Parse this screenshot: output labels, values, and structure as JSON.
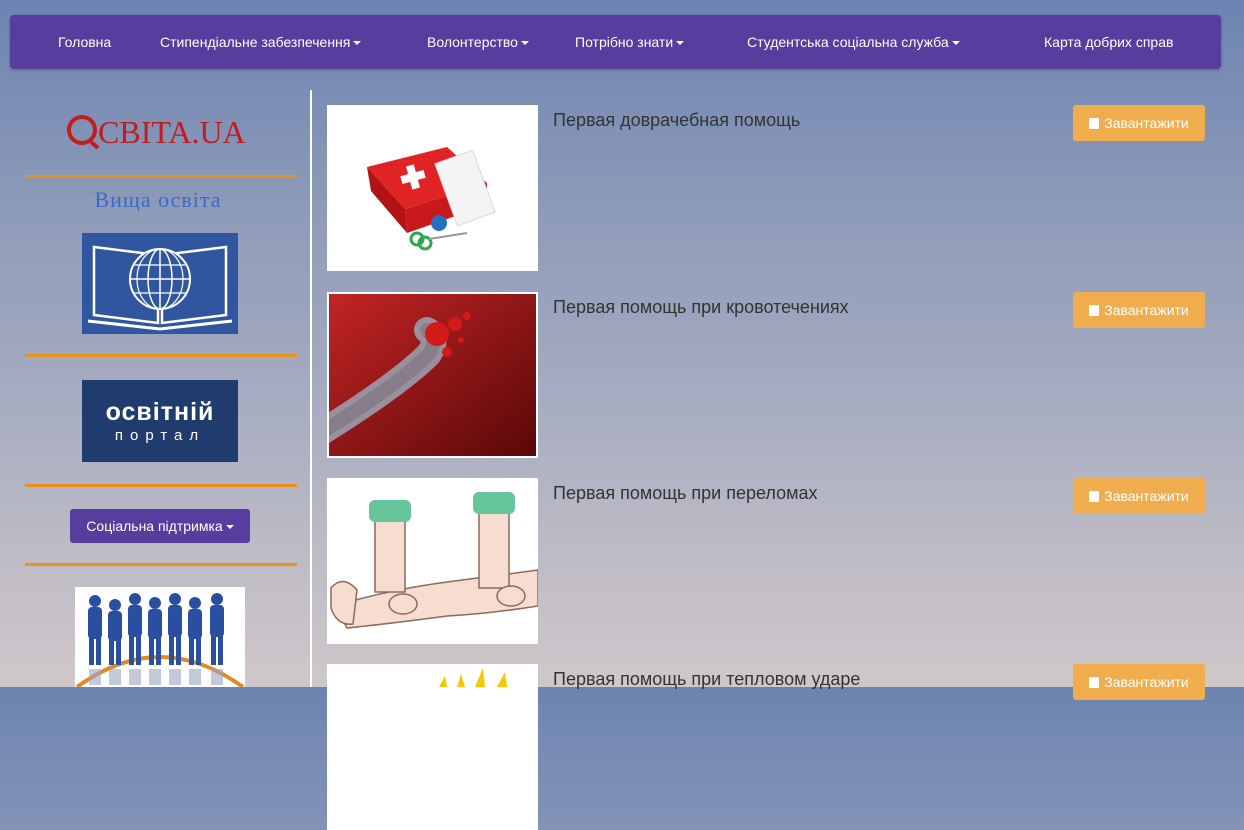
{
  "nav": {
    "items": [
      {
        "label": "Головна",
        "dropdown": false
      },
      {
        "label": "Стипендіальне забезпечення",
        "dropdown": true
      },
      {
        "label": "Волонтерство",
        "dropdown": true
      },
      {
        "label": "Потрібно знати",
        "dropdown": true
      },
      {
        "label": "Студентська соціальна служба",
        "dropdown": true
      },
      {
        "label": "Карта добрих справ",
        "dropdown": false
      }
    ]
  },
  "sidebar": {
    "osvita_logo_text": "CBITA.UA",
    "vysha_osvita": "Вища освіта",
    "portal_line1": "освітній",
    "portal_line2": "портал",
    "social_support_label": "Соціальна підтримка"
  },
  "documents": [
    {
      "title": "Первая доврачебная помощь",
      "button": "Завантажити"
    },
    {
      "title": "Первая помощь при кровотечениях",
      "button": "Завантажити"
    },
    {
      "title": "Первая помощь при переломах",
      "button": "Завантажити"
    },
    {
      "title": "Первая помощь при тепловом ударе",
      "button": "Завантажити"
    }
  ],
  "colors": {
    "navbar": "#563d9e",
    "divider_orange": "#eb8f1d",
    "download_button": "#f0ad4e",
    "logo_red": "#c31c1c",
    "vysha_blue": "#3a6ac8"
  }
}
